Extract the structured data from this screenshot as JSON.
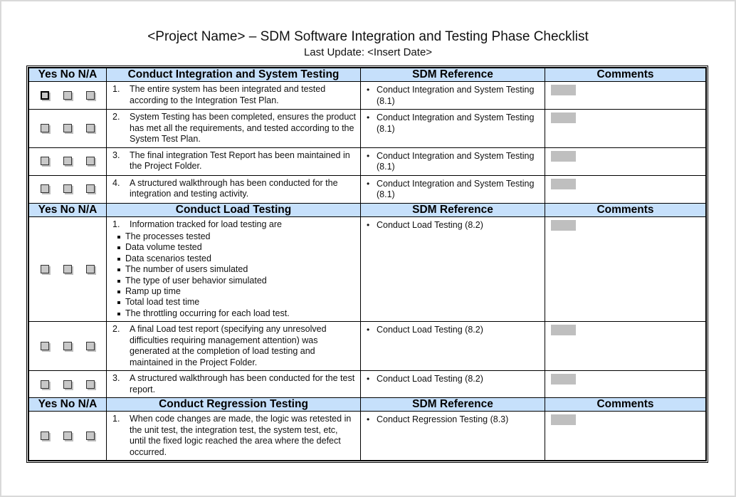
{
  "document": {
    "title": "<Project Name> – SDM Software Integration and Testing Phase Checklist",
    "subtitle": "Last Update: <Insert Date>"
  },
  "colors": {
    "header_background": "#c6e0fb",
    "form_field": "#bfbfbf",
    "checkbox_fill": "#c8c8c8"
  },
  "column_headers": {
    "check": "Yes No N/A",
    "reference": "SDM Reference",
    "comments": "Comments"
  },
  "sections": [
    {
      "title": "Conduct Integration and System Testing",
      "items": [
        {
          "num": "1.",
          "text": "The entire system has been integrated and tested according to the Integration Test Plan.",
          "sub": [],
          "reference": "Conduct Integration and System Testing (8.1)",
          "checkboxes": [
            "yes",
            "no",
            "n/a"
          ],
          "focused": "yes"
        },
        {
          "num": "2.",
          "text": "System Testing has been completed, ensures the product has met all the requirements, and tested according to the System Test Plan.",
          "sub": [],
          "reference": "Conduct Integration and System Testing (8.1)"
        },
        {
          "num": "3.",
          "text": "The final integration Test Report has been maintained in the Project Folder.",
          "sub": [],
          "reference": "Conduct Integration and System Testing (8.1)"
        },
        {
          "num": "4.",
          "text": "A structured walkthrough has been conducted for the integration and testing activity.",
          "sub": [],
          "reference": "Conduct Integration and System Testing (8.1)"
        }
      ]
    },
    {
      "title": "Conduct Load Testing",
      "items": [
        {
          "num": "1.",
          "text": "Information tracked for load testing are",
          "sub": [
            "The processes tested",
            "Data volume tested",
            "Data scenarios tested",
            "The number of users simulated",
            "The type of user behavior simulated",
            "Ramp up time",
            "Total load test time",
            "The throttling occurring for each load test."
          ],
          "reference": "Conduct Load Testing (8.2)"
        },
        {
          "num": "2.",
          "text": "A final Load test report (specifying any unresolved difficulties requiring management attention) was generated at the completion of load testing and maintained in the Project Folder.",
          "sub": [],
          "reference": "Conduct Load Testing (8.2)"
        },
        {
          "num": "3.",
          "text": "A structured walkthrough has been conducted for the test report.",
          "sub": [],
          "reference": "Conduct Load Testing (8.2)"
        }
      ]
    },
    {
      "title": "Conduct Regression Testing",
      "items": [
        {
          "num": "1.",
          "text": "When code changes are made, the logic was retested in the unit test, the integration test, the system test, etc, until the fixed logic reached the area where the defect occurred.",
          "sub": [],
          "reference": "Conduct Regression Testing (8.3)"
        }
      ]
    }
  ]
}
